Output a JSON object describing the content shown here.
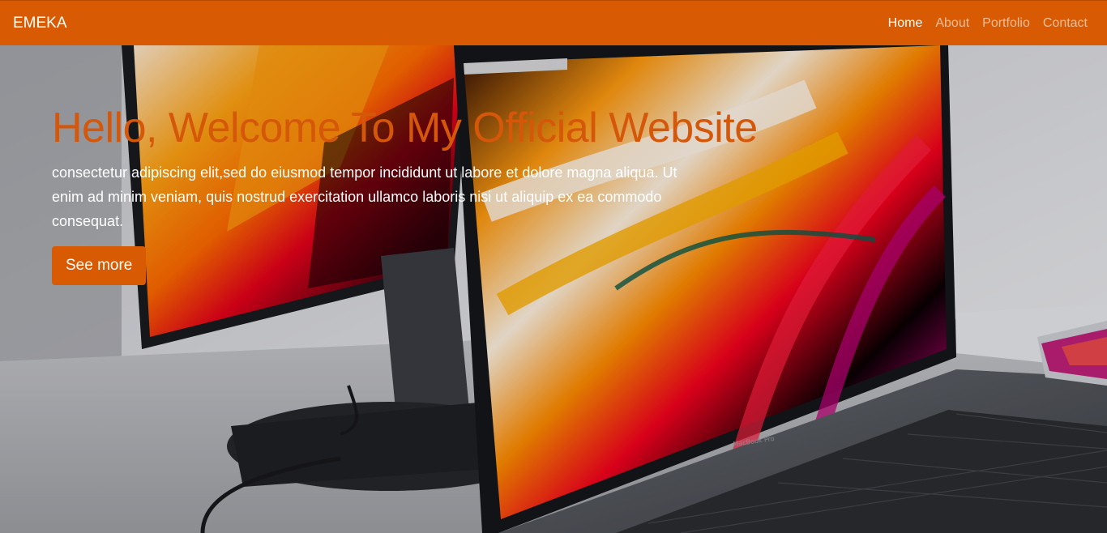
{
  "navbar": {
    "brand": "EMEKA",
    "links": [
      {
        "label": "Home",
        "active": true
      },
      {
        "label": "About",
        "active": false
      },
      {
        "label": "Portfolio",
        "active": false
      },
      {
        "label": "Contact",
        "active": false
      }
    ]
  },
  "hero": {
    "title": "Hello, Welcome To My Official Website",
    "text": "consectetur adipiscing elit,sed do eiusmod tempor incididunt ut labore et dolore magna aliqua. Ut enim ad minim veniam, quis nostrud exercitation ullamco laboris nisi ut aliquip ex ea commodo consequat.",
    "button_label": "See more",
    "background_image": "laptop-and-monitor-photo",
    "laptop_label": "MacBook Pro"
  },
  "colors": {
    "accent": "#d85a02",
    "title": "#d4570a"
  }
}
